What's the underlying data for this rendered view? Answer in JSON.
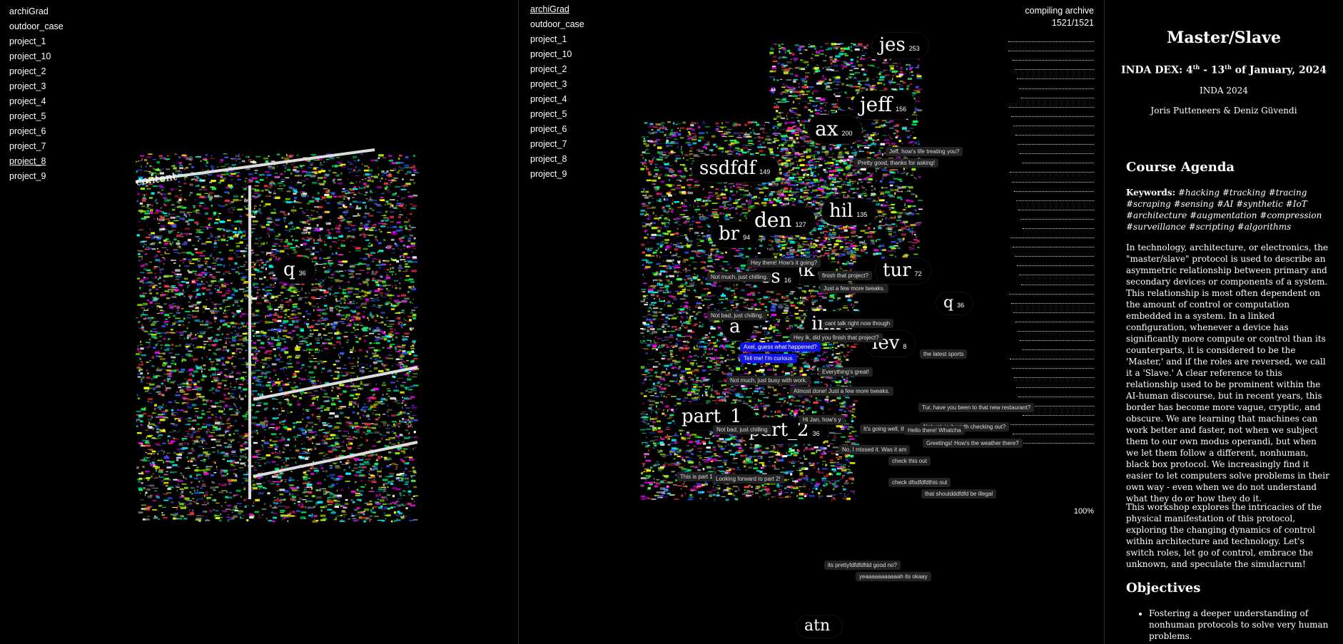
{
  "projects": [
    "archiGrad",
    "outdoor_case",
    "project_1",
    "project_10",
    "project_2",
    "project_3",
    "project_4",
    "project_5",
    "project_6",
    "project_7",
    "project_8",
    "project_9"
  ],
  "left": {
    "active": "project_8",
    "overlay_text": "content",
    "bubble": {
      "label": "q",
      "count": "36"
    }
  },
  "middle": {
    "active": "archiGrad",
    "compile": {
      "label": "compiling archive",
      "progress": "1521/1521",
      "percent_label": "100%",
      "fraction": 1.0
    },
    "bubbles": [
      {
        "label": "jes",
        "count": "253"
      },
      {
        "label": "jeff",
        "count": "156"
      },
      {
        "label": "ax",
        "count": "200"
      },
      {
        "label": "ssdfdf",
        "count": "149"
      },
      {
        "label": "hil",
        "count": "135"
      },
      {
        "label": "den",
        "count": "127"
      },
      {
        "label": "br",
        "count": "94"
      },
      {
        "label": "ik",
        "count": "65"
      },
      {
        "label": "ss",
        "count": "16"
      },
      {
        "label": "tur",
        "count": "72"
      },
      {
        "label": "q",
        "count": "36"
      },
      {
        "label": "a",
        "count": ""
      },
      {
        "label": "inn",
        "count": "14"
      },
      {
        "label": "lev",
        "count": "8"
      },
      {
        "label": "part_1",
        "count": ""
      },
      {
        "label": "part_2",
        "count": "36"
      },
      {
        "label": "atn",
        "count": ""
      }
    ],
    "messages": [
      "Jeff, how's life treating you?",
      "Pretty good, thanks for asking!",
      "Hey there! How's it going?",
      "Not much, just chilling.",
      "finish that project?",
      "Just a few more tweaks.",
      "Not bad, just chilling.",
      "cant talk right now though",
      "Hey lk, did you finish that project?",
      "Axel, guess what happened?",
      "Tell me! I'm curious.",
      "Everything's great!",
      "Not much, just busy with work.",
      "Almost done! Just a few more tweaks.",
      "Hi Jan, how's y",
      "It's going well, thanks for",
      "No, I missed it. Was it am",
      "Tur, have you been to that new restaurant?",
      "Not yet, is it worth checking out?",
      "Greetings! How's the weather there?",
      "check this out",
      "check dfsdfdfdthis out",
      "that shouldddfdfd be illegal",
      "its prettyfdfdfdfdd good no?",
      "yeaaaaaaaaaaah its okaay",
      "This is part 1",
      "Looking forward to part 2!",
      "the latest sports",
      "Hello there! Whatcha",
      "Not bad, just chilling"
    ]
  },
  "right": {
    "title": "Master/Slave",
    "subtitle_prefix": "INDA DEX: 4",
    "subtitle_sup1": "th",
    "subtitle_mid": " - 13",
    "subtitle_sup2": "th",
    "subtitle_suffix": " of January, 2024",
    "org": "INDA 2024",
    "authors": "Joris Putteneers & Deniz Güvendi",
    "agenda_heading": "Course Agenda",
    "keywords_label": "Keywords:",
    "keywords": "#hacking #tracking #tracing #scraping #sensing #AI #synthetic #IoT #architecture #augmentation #compression #surveillance #scripting #algorithms",
    "para1": "In technology, architecture, or electronics, the \"master/slave\" protocol is used to describe an asymmetric relationship between primary and secondary devices or components of a system. This relationship is most often dependent on the amount of control or computation embedded in a system. In a linked configuration, whenever a device has significantly more compute or control than its counterparts, it is considered to be the 'Master,' and if the roles are reversed, we call it a 'Slave.' A clear reference to this relationship used to be prominent within the AI-human discourse, but in recent years, this border has become more vague, cryptic, and obscure. We are learning that machines can work better and faster, not when we subject them to our own modus operandi, but when we let them follow a different, nonhuman, black box protocol. We increasingly find it easier to let computers solve problems in their own way - even when we do not understand what they do or how they do it.",
    "para2": "This workshop explores the intricacies of the physical manifestation of this protocol, exploring the changing dynamics of control within architecture and technology. Let's switch roles, let go of control, embrace the unknown, and speculate the simulacrum!",
    "objectives_heading": "Objectives",
    "objectives": [
      "Fostering a deeper understanding of nonhuman protocols to solve very human problems."
    ]
  }
}
